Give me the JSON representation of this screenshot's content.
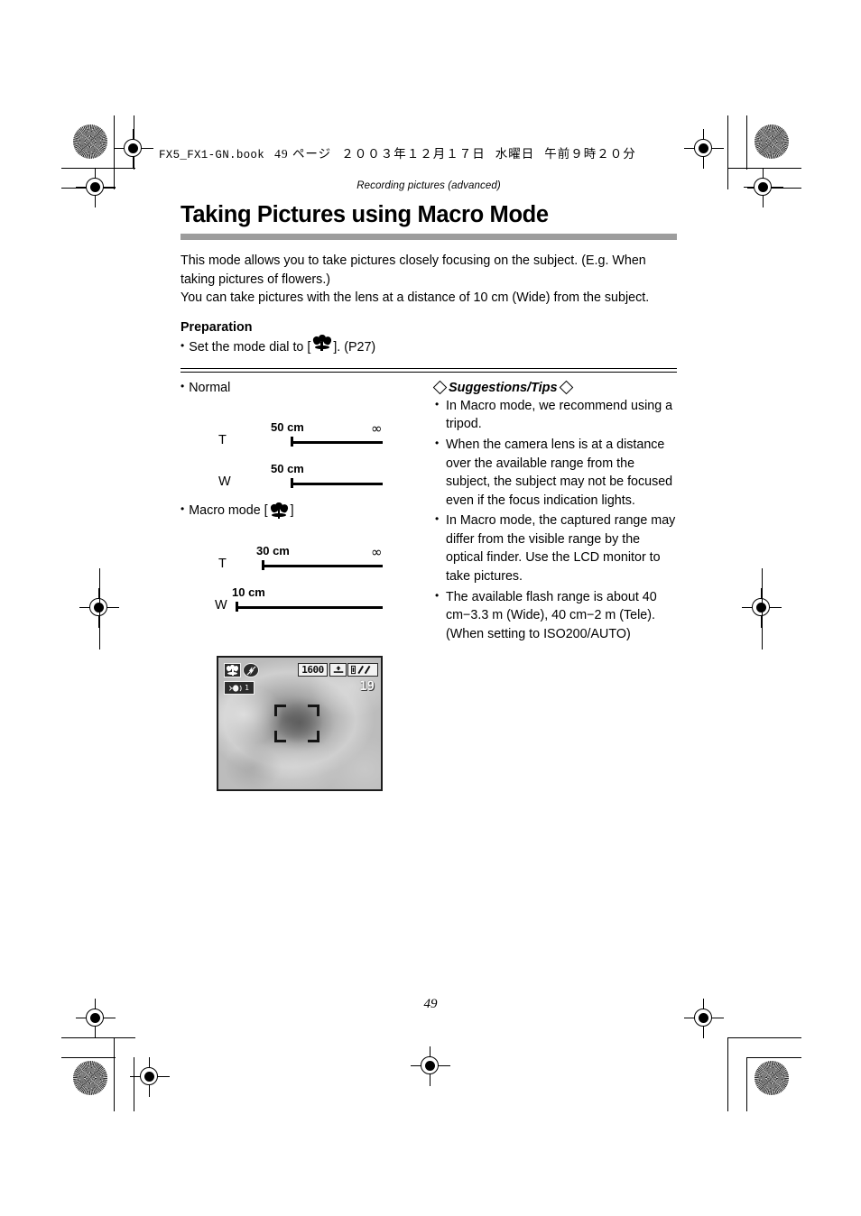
{
  "print_header": {
    "filename": "FX5_FX1-GN.book",
    "page_label": "49 ページ",
    "date": "２００３年１２月１７日",
    "weekday": "水曜日",
    "time": "午前９時２０分"
  },
  "running_head": "Recording pictures (advanced)",
  "title": "Taking Pictures using Macro Mode",
  "intro": {
    "paragraph1": "This mode allows you to take pictures closely focusing on the subject. (E.g. When taking pictures of flowers.)",
    "paragraph2": "You can take pictures with the lens at a distance of 10 cm (Wide) from the subject."
  },
  "preparation": {
    "heading": "Preparation",
    "bullet_dot": "•",
    "text_before_icon": "Set the mode dial to [",
    "icon_name": "macro-flower-icon",
    "text_after_icon": "]. (P27)"
  },
  "left_column": {
    "normal": {
      "bullet_dot": "•",
      "label": "Normal",
      "rows": [
        {
          "zoom": "T",
          "near": "50 cm",
          "far": "∞"
        },
        {
          "zoom": "W",
          "near": "50 cm",
          "far": ""
        }
      ]
    },
    "macro": {
      "bullet_dot": "•",
      "label_before_icon": "Macro mode [",
      "icon_name": "macro-flower-icon",
      "label_after_icon": "]",
      "rows": [
        {
          "zoom": "T",
          "near": "30 cm",
          "far": "∞"
        },
        {
          "zoom": "W",
          "near": "10 cm",
          "far": ""
        }
      ]
    }
  },
  "tips": {
    "heading": "Suggestions/Tips",
    "bullet_dot": "•",
    "items": [
      "In Macro mode, we recommend using a tripod.",
      "When the camera lens is at a distance over the available range from the subject, the subject may not be focused even if the focus indication lights.",
      "In Macro mode, the captured range may differ from the visible range by the optical finder. Use the LCD monitor to take pictures.",
      "The available flash range is about 40 cm−3.3 m (Wide), 40 cm−2 m (Tele). (When setting to ISO200/AUTO)"
    ]
  },
  "lcd_screen": {
    "description": "Camera LCD live view showing a close-up rose",
    "osd": {
      "macro_icon_name": "macro-flower-icon",
      "flash_off_icon_name": "flash-off-icon",
      "stabilizer_icon_name": "image-stabilizer-icon",
      "stabilizer_mode": "1",
      "resolution": "1600",
      "quality_icon_name": "fine-quality-icon",
      "battery_icon_name": "battery-icon",
      "card_icon_name": "card-slashes-icon",
      "shots_remaining": "19"
    }
  },
  "folio": "49",
  "colors": {
    "title_rule": "#9d9d9d",
    "text": "#000000",
    "lcd_border": "#1c1c1c"
  }
}
